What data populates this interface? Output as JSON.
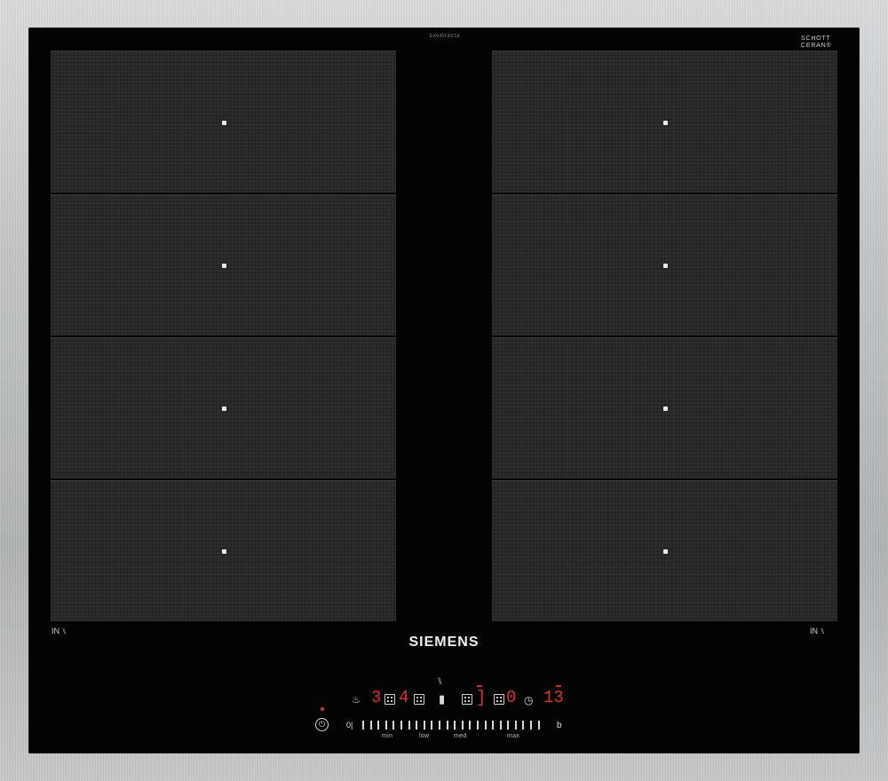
{
  "brand": "SIEMENS",
  "glass_maker": [
    "SCHOTT",
    "CERAN®"
  ],
  "serial_text": "EX645FXC1E",
  "colors": {
    "glass": "#030303",
    "zone": "#232323",
    "led_red": "#e0301e",
    "frame": "#c0c3c4"
  },
  "cooking_zones": {
    "left": [
      "zone-1",
      "zone-2",
      "zone-3",
      "zone-4"
    ],
    "right": [
      "zone-1",
      "zone-2",
      "zone-3",
      "zone-4"
    ]
  },
  "corner_labels": {
    "left": "IN ⑊",
    "right": "IN ⑊"
  },
  "controls": {
    "power_icon": "power-icon",
    "flex_icon": "flex-zone-icon",
    "digits": {
      "zone_a": "3",
      "zone_b": "4",
      "zone_c": "]",
      "zone_d": "0",
      "timer": "13"
    },
    "boost_label": "b",
    "zero_label": "0|",
    "scale_labels": [
      "min",
      "low",
      "med",
      "max"
    ]
  }
}
